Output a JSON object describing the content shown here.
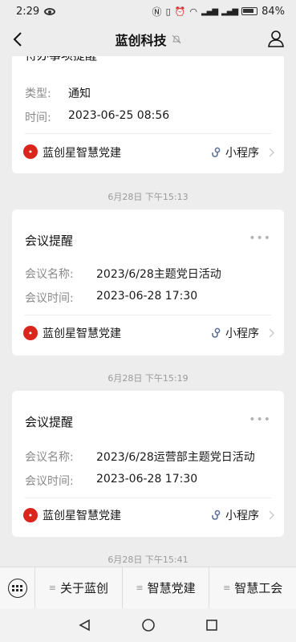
{
  "status_bar": {
    "time": "2:29",
    "icons_right": [
      "nfc-icon",
      "vibrate-icon",
      "alarm-icon",
      "wifi-icon",
      "signal-icon",
      "battery-icon"
    ],
    "signal_text_1": "ᵢₗ",
    "signal_text_2": "ᵢₗ",
    "battery_percent": "84%"
  },
  "header": {
    "title": "蓝创科技"
  },
  "messages": [
    {
      "title": "待办事项提醒",
      "fields": [
        {
          "label": "类型:",
          "value": "通知"
        },
        {
          "label": "时间:",
          "value": "2023-06-25 08:56"
        }
      ],
      "source": "蓝创星智慧党建",
      "mini_program": "小程序"
    },
    {
      "timestamp": "6月28日 下午15:13",
      "title": "会议提醒",
      "fields": [
        {
          "label": "会议名称:",
          "value": "2023/6/28主题党日活动"
        },
        {
          "label": "会议时间:",
          "value": "2023-06-28 17:30"
        }
      ],
      "source": "蓝创星智慧党建",
      "mini_program": "小程序"
    },
    {
      "timestamp": "6月28日 下午15:19",
      "title": "会议提醒",
      "fields": [
        {
          "label": "会议名称:",
          "value": "2023/6/28运营部主题党日活动"
        },
        {
          "label": "会议时间:",
          "value": "2023-06-28 17:30"
        }
      ],
      "source": "蓝创星智慧党建",
      "mini_program": "小程序"
    },
    {
      "timestamp": "6月28日 下午15:41"
    }
  ],
  "menu": {
    "items": [
      "关于蓝创",
      "智慧党建",
      "智慧工会"
    ]
  },
  "colors": {
    "background": "#ededed",
    "card": "#ffffff",
    "logo_red": "#d9251c",
    "mini_program_blue": "#576b95"
  }
}
